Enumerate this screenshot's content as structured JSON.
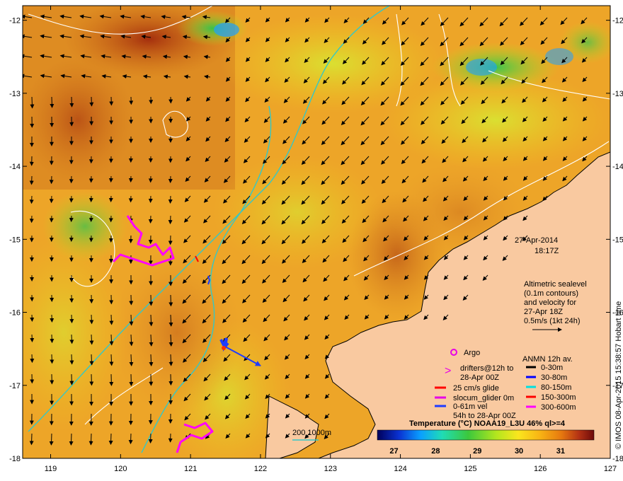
{
  "date_label": "27-Apr-2014",
  "time_label": "18:17Z",
  "altimetry_note": [
    "Altimetric sealevel",
    "(0.1m contours)",
    "and velocity for",
    "27-Apr 18Z",
    "0.5m/s (1kt 24h)"
  ],
  "legend": {
    "argo": "Argo",
    "drifters": [
      "drifters@12h to",
      "28-Apr 00Z"
    ],
    "glide": "25 cm/s glide",
    "slocum": "slocum_glider 0m",
    "vel": [
      "0-61m vel",
      "54h to 28-Apr 00Z"
    ],
    "anmn_title": "ANMN 12h av.",
    "anmn": [
      {
        "label": "0-30m",
        "color": "#000000"
      },
      {
        "label": "30-80m",
        "color": "#0000ff"
      },
      {
        "label": "80-150m",
        "color": "#00e0e0"
      },
      {
        "label": "150-300m",
        "color": "#ff0000"
      },
      {
        "label": "300-600m",
        "color": "#ff00ff"
      }
    ],
    "isobath": "200  1000m"
  },
  "colorbar": {
    "title": "Temperature (°C) NOAA19_L3U 46% ql>=4",
    "ticks": [
      "27",
      "28",
      "29",
      "30",
      "31"
    ],
    "range": [
      26.6,
      31.8
    ]
  },
  "side_credit": "© IMOS 08-Apr-2015 15:38:57 Hobart time",
  "axes": {
    "x_ticks": [
      "119",
      "120",
      "121",
      "122",
      "123",
      "124",
      "125",
      "126",
      "127"
    ],
    "y_ticks": [
      "-12",
      "-13",
      "-14",
      "-15",
      "-16",
      "-17",
      "-18"
    ],
    "x_range": [
      118.6,
      127
    ],
    "y_range": [
      -18,
      -11.8
    ]
  },
  "colors": {
    "land": "#f9c9a0",
    "coast": "#000000",
    "isobath": "#32c8c8",
    "contour": "#ffffff",
    "arrow": "#000000",
    "glider_track": "#ff00ff",
    "drifter": "#1e3cff"
  }
}
